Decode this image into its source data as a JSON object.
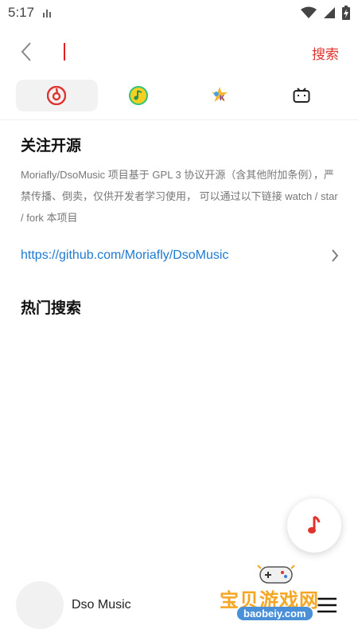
{
  "status_bar": {
    "time": "5:17"
  },
  "toolbar": {
    "search_placeholder": "",
    "search_label": "搜索"
  },
  "source_tabs": [
    {
      "name": "netease",
      "active": true
    },
    {
      "name": "qq-music",
      "active": false
    },
    {
      "name": "kuwo",
      "active": false
    },
    {
      "name": "bilibili",
      "active": false
    }
  ],
  "notice": {
    "title": "关注开源",
    "body": "Moriafly/DsoMusic 项目基于 GPL 3 协议开源（含其他附加条例），严禁传播、倒卖，仅供开发者学习使用， 可以通过以下链接 watch / star / fork 本项目",
    "link": "https://github.com/Moriafly/DsoMusic"
  },
  "hot_search": {
    "title": "热门搜索"
  },
  "player": {
    "title": "Dso Music"
  },
  "watermark": {
    "text": "宝贝游戏网",
    "domain": "baobeiy.com"
  },
  "colors": {
    "accent": "#e0332f",
    "link": "#1e7ad0"
  }
}
